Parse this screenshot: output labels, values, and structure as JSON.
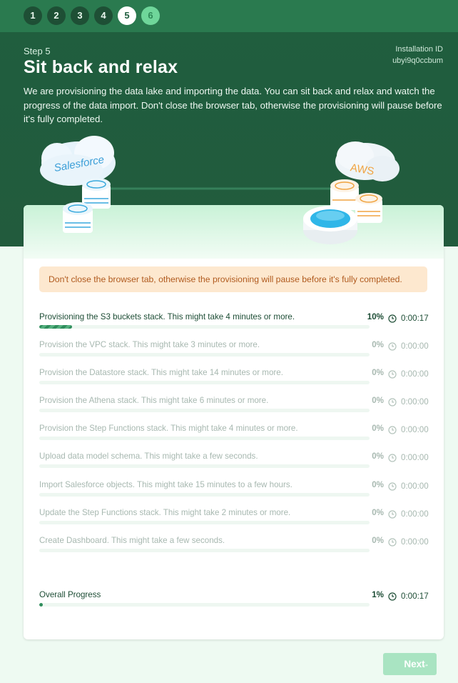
{
  "steps": [
    "1",
    "2",
    "3",
    "4",
    "5",
    "6"
  ],
  "active_step": 5,
  "header": {
    "step_label": "Step 5",
    "title": "Sit back and relax",
    "description": "We are provisioning the data lake and importing the data. You can sit back and relax and watch the progress of the data import. Don't close the browser tab, otherwise the provisioning will pause before it's fully completed.",
    "installation_label": "Installation ID",
    "installation_id": "ubyi9q0ccbum"
  },
  "illustration": {
    "source_label": "Salesforce",
    "target_label": "AWS"
  },
  "alert": "Don't close the browser tab, otherwise the provisioning will pause before it's fully completed.",
  "tasks": [
    {
      "label": "Provisioning the S3 buckets stack. This might take 4 minutes or more.",
      "percent": "10%",
      "progress": 0.1,
      "time": "0:00:17",
      "active": true
    },
    {
      "label": "Provision the VPC stack. This might take 3 minutes or more.",
      "percent": "0%",
      "progress": 0,
      "time": "0:00:00",
      "active": false
    },
    {
      "label": "Provision the Datastore stack. This might take 14 minutes or more.",
      "percent": "0%",
      "progress": 0,
      "time": "0:00:00",
      "active": false
    },
    {
      "label": "Provision the Athena stack. This might take 6 minutes or more.",
      "percent": "0%",
      "progress": 0,
      "time": "0:00:00",
      "active": false
    },
    {
      "label": "Provision the Step Functions stack. This might take 4 minutes or more.",
      "percent": "0%",
      "progress": 0,
      "time": "0:00:00",
      "active": false
    },
    {
      "label": "Upload data model schema. This might take a few seconds.",
      "percent": "0%",
      "progress": 0,
      "time": "0:00:00",
      "active": false
    },
    {
      "label": "Import Salesforce objects. This might take 15 minutes to a few hours.",
      "percent": "0%",
      "progress": 0,
      "time": "0:00:00",
      "active": false
    },
    {
      "label": "Update the Step Functions stack. This might take 2 minutes or more.",
      "percent": "0%",
      "progress": 0,
      "time": "0:00:00",
      "active": false
    },
    {
      "label": "Create Dashboard. This might take a few seconds.",
      "percent": "0%",
      "progress": 0,
      "time": "0:00:00",
      "active": false
    }
  ],
  "overall": {
    "label": "Overall Progress",
    "percent": "1%",
    "progress": 0.01,
    "time": "0:00:17"
  },
  "next_button": "Next",
  "icons": {
    "timer": "clock-icon",
    "next": "arrow-right-icon"
  },
  "colors": {
    "brand": "#1f5e3e",
    "accent": "#2f8d5c",
    "alert_bg": "#fde8cf",
    "alert_text": "#b05a1e"
  }
}
